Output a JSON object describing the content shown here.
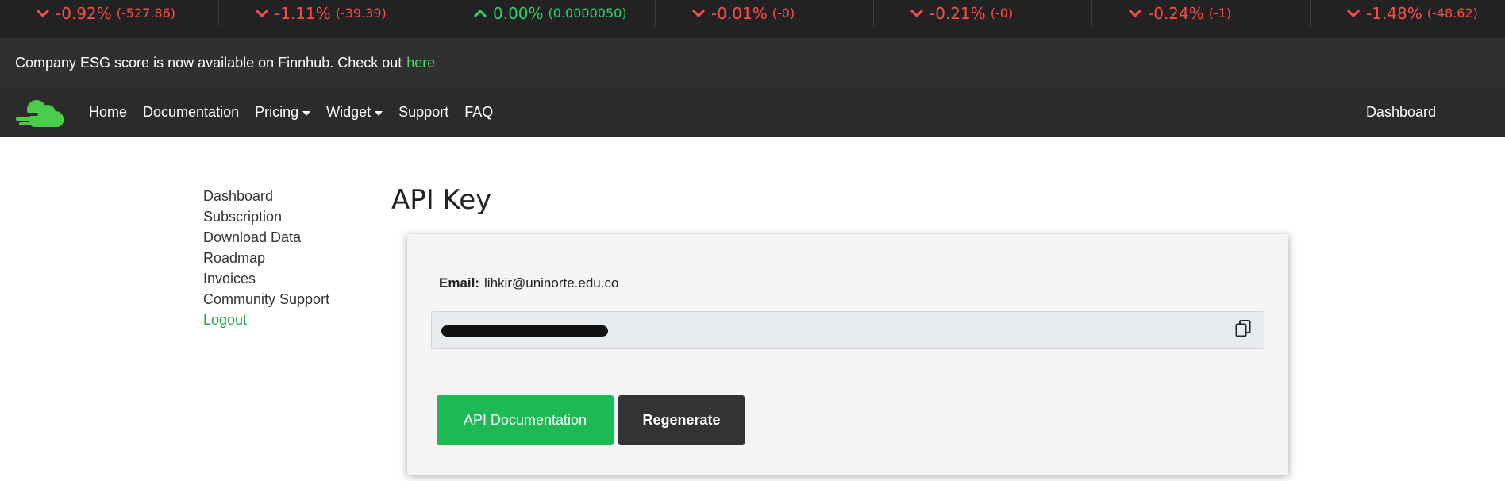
{
  "ticker": [
    {
      "direction": "down",
      "pct": "-0.92%",
      "change": "(-527.86)"
    },
    {
      "direction": "down",
      "pct": "-1.11%",
      "change": "(-39.39)"
    },
    {
      "direction": "up",
      "pct": "0.00%",
      "change": "(0.0000050)"
    },
    {
      "direction": "down",
      "pct": "-0.01%",
      "change": "(-0)"
    },
    {
      "direction": "down",
      "pct": "-0.21%",
      "change": "(-0)"
    },
    {
      "direction": "down",
      "pct": "-0.24%",
      "change": "(-1)"
    },
    {
      "direction": "down",
      "pct": "-1.48%",
      "change": "(-48.62)"
    }
  ],
  "announcement": {
    "text": "Company ESG score is now available on Finnhub. Check out",
    "link": "here"
  },
  "navbar": {
    "logo_icon": "cloud-logo-icon",
    "links": [
      "Home",
      "Documentation",
      "Pricing",
      "Widget",
      "Support",
      "FAQ"
    ],
    "right": "Dashboard"
  },
  "sidebar": {
    "items": [
      "Dashboard",
      "Subscription",
      "Download Data",
      "Roadmap",
      "Invoices",
      "Community Support"
    ],
    "logout": "Logout"
  },
  "main": {
    "title": "API Key",
    "email_label": "Email:",
    "email_value": "lihkir@uninorte.edu.co",
    "key_value": "[redacted]",
    "copy_icon": "copy-icon",
    "doc_button": "API Documentation",
    "regen_button": "Regenerate"
  },
  "colors": {
    "down": "#ff4b4b",
    "up": "#2bd36a",
    "accent_green": "#1db954",
    "dark": "#2b2b2b"
  }
}
